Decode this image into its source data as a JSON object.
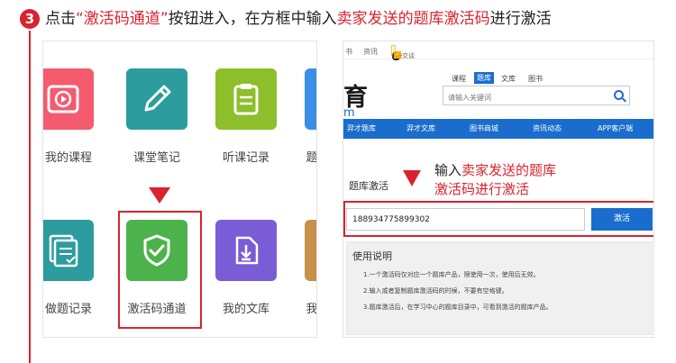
{
  "step": {
    "number": "3"
  },
  "instruction": {
    "p1": "点击",
    "quote_open": "“",
    "entry_name": "激活码通道",
    "quote_close": "”",
    "p2": "按钮进入，在方框中输入",
    "highlight": "卖家发送的题库激活码",
    "p3": "进行激活"
  },
  "app_grid": {
    "tiles": [
      {
        "label": "我的课程",
        "color": "#f45b6e",
        "icon": "play-video-icon"
      },
      {
        "label": "课堂笔记",
        "color": "#2c9c9e",
        "icon": "pencil-icon"
      },
      {
        "label": "听课记录",
        "color": "#8cbf2a",
        "icon": "clipboard-icon"
      },
      {
        "label": "题",
        "color": "#3a8ee6",
        "icon": "partial-icon"
      },
      {
        "label": "做题记录",
        "color": "#2c9c9e",
        "icon": "exercise-record-icon"
      },
      {
        "label": "激活码通道",
        "color": "#4cb34c",
        "icon": "shield-check-icon"
      },
      {
        "label": "我的文库",
        "color": "#7a5cd6",
        "icon": "document-download-icon"
      },
      {
        "label": "我",
        "color": "#c8914a",
        "icon": "partial-icon"
      }
    ]
  },
  "web": {
    "topbar": {
      "item1": "书",
      "item2": "资讯",
      "qq_label": "QQ交谈"
    },
    "logo": {
      "main": "育",
      "sub": "m"
    },
    "search": {
      "tabs": [
        "课程",
        "题库",
        "文库",
        "图书"
      ],
      "active_tab": "题库",
      "placeholder": "请输入关键词"
    },
    "nav": [
      "羿才题库",
      "羿才文库",
      "图书商城",
      "资讯动态",
      "APP客户端"
    ],
    "section_title": "题库激活",
    "annotation": {
      "p1": "输入",
      "highlight": "卖家发送的题库",
      "line2": "激活码进行激活"
    },
    "activation": {
      "code": "188934775899302",
      "button": "激活"
    },
    "usage": {
      "title": "使用说明",
      "lines": [
        "1.一个激活码仅对应一个题库产品，限使用一次，使用后无效。",
        "2.输入或者复制题库激活码的时候，不要有空格键。",
        "3.题库激活后，在学习中心的题库目录中，可看到激活的题库产品。"
      ]
    }
  },
  "colors": {
    "accent_red": "#d9232e",
    "brand_blue": "#1a6dcc"
  }
}
